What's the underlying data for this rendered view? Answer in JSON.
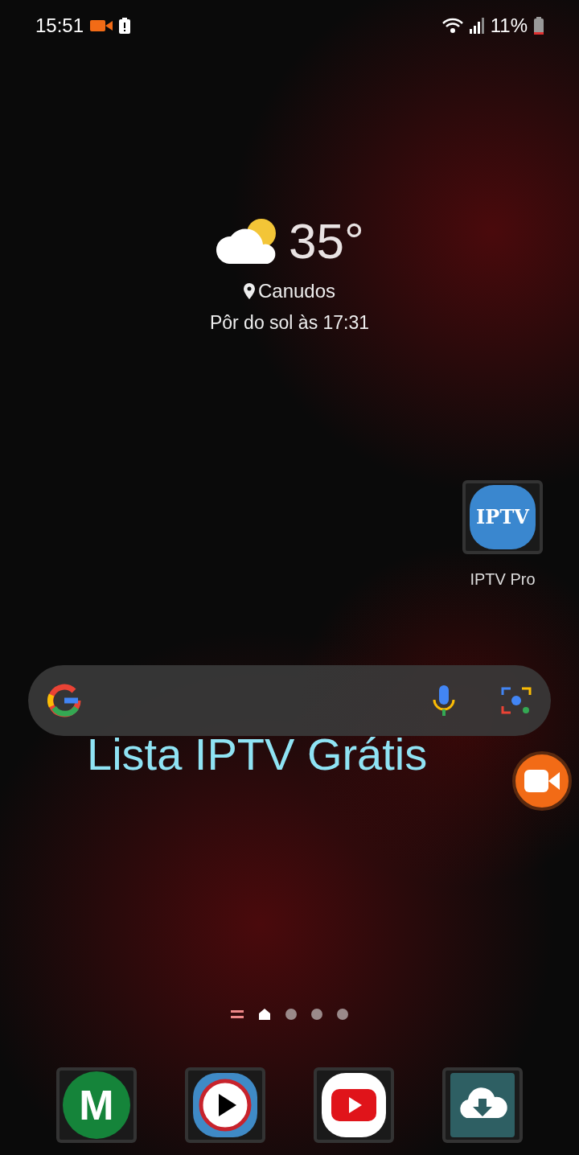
{
  "status_bar": {
    "time": "15:51",
    "battery": "11%"
  },
  "weather": {
    "temperature": "35°",
    "location": "Canudos",
    "sunset": "Pôr do sol às 17:31"
  },
  "apps": [
    {
      "icon_text": "IPTV",
      "label": "IPTV Pro"
    }
  ],
  "caption": "Lista IPTV Grátis",
  "page_indicator": [
    {
      "kind": "home",
      "selected": true
    },
    {
      "kind": "dot",
      "selected": false
    },
    {
      "kind": "dot",
      "selected": false
    },
    {
      "kind": "dot",
      "selected": false
    }
  ],
  "dock": [
    {
      "kind": "letter",
      "text": "M"
    },
    {
      "kind": "player"
    },
    {
      "kind": "video"
    },
    {
      "kind": "download"
    }
  ]
}
